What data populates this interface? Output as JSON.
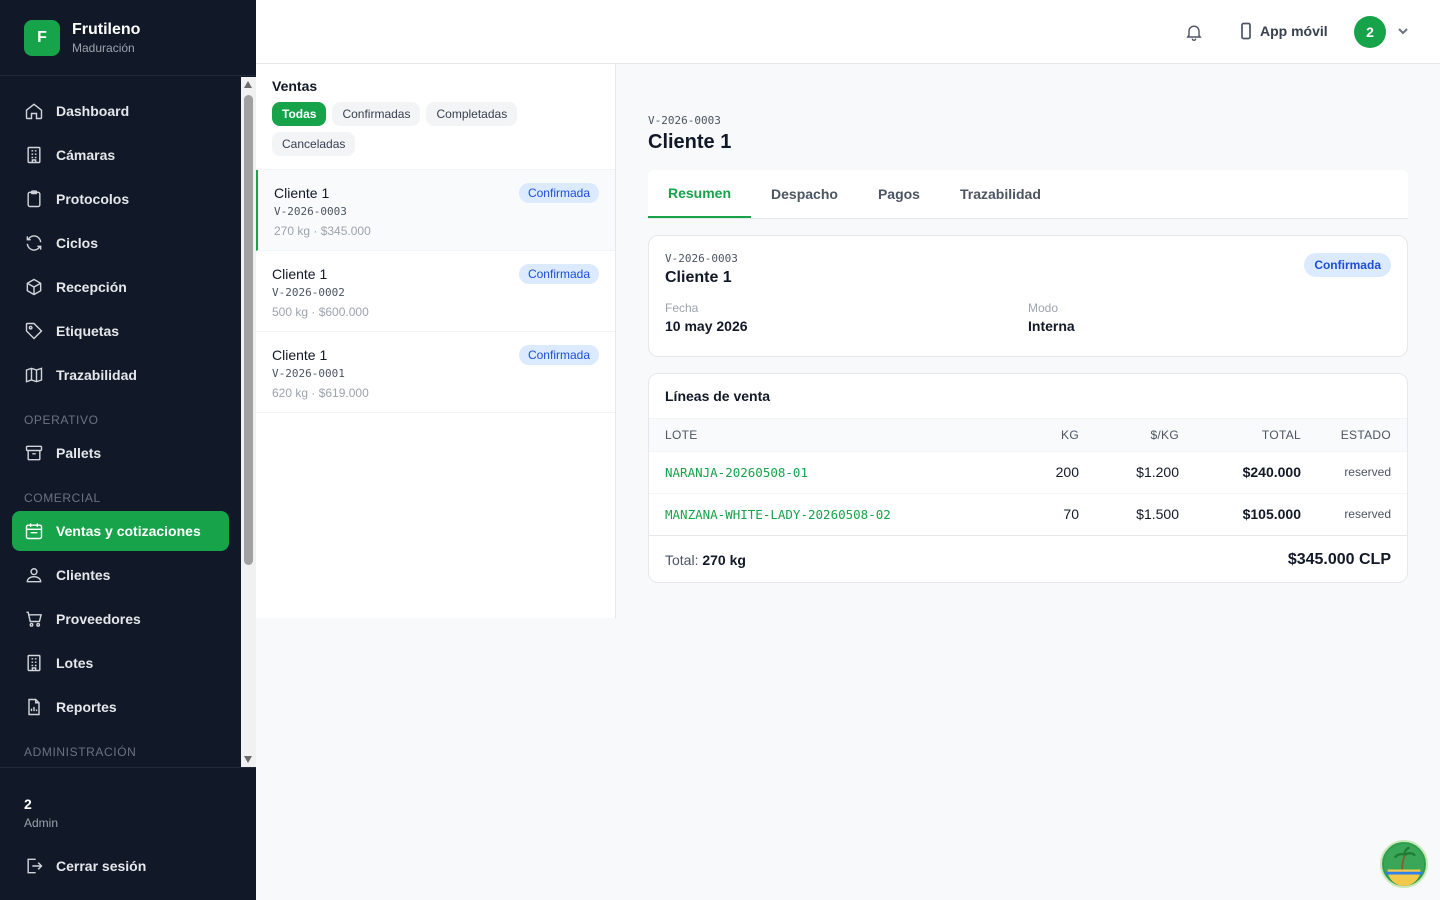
{
  "brand": {
    "initial": "F",
    "name": "Frutileno",
    "subtitle": "Maduración"
  },
  "nav": {
    "main": [
      "Dashboard",
      "Cámaras",
      "Protocolos",
      "Ciclos",
      "Recepción",
      "Etiquetas",
      "Trazabilidad"
    ],
    "section_operativo": "OPERATIVO",
    "operativo": [
      "Pallets"
    ],
    "section_comercial": "COMERCIAL",
    "comercial": [
      "Ventas y cotizaciones",
      "Clientes",
      "Proveedores",
      "Lotes",
      "Reportes"
    ],
    "section_admin": "ADMINISTRACIÓN",
    "active": "Ventas y cotizaciones"
  },
  "user": {
    "name": "2",
    "role": "Admin",
    "logout": "Cerrar sesión",
    "avatar": "2"
  },
  "topbar": {
    "app_movil": "App móvil"
  },
  "list": {
    "title": "Ventas",
    "filters": [
      "Todas",
      "Confirmadas",
      "Completadas",
      "Canceladas"
    ],
    "items": [
      {
        "client": "Cliente 1",
        "code": "V-2026-0003",
        "meta": "270 kg · $345.000",
        "status": "Confirmada"
      },
      {
        "client": "Cliente 1",
        "code": "V-2026-0002",
        "meta": "500 kg · $600.000",
        "status": "Confirmada"
      },
      {
        "client": "Cliente 1",
        "code": "V-2026-0001",
        "meta": "620 kg · $619.000",
        "status": "Confirmada"
      }
    ]
  },
  "detail": {
    "code": "V-2026-0003",
    "client": "Cliente 1",
    "tabs": [
      "Resumen",
      "Despacho",
      "Pagos",
      "Trazabilidad"
    ],
    "summary": {
      "code": "V-2026-0003",
      "client": "Cliente 1",
      "status": "Confirmada",
      "fecha_label": "Fecha",
      "fecha": "10 may 2026",
      "modo_label": "Modo",
      "modo": "Interna"
    },
    "lines": {
      "title": "Líneas de venta",
      "headers": [
        "LOTE",
        "KG",
        "$/KG",
        "TOTAL",
        "ESTADO"
      ],
      "rows": [
        {
          "lote": "NARANJA-20260508-01",
          "kg": "200",
          "price": "$1.200",
          "total": "$240.000",
          "estado": "reserved"
        },
        {
          "lote": "MANZANA-WHITE-LADY-20260508-02",
          "kg": "70",
          "price": "$1.500",
          "total": "$105.000",
          "estado": "reserved"
        }
      ],
      "total_label": "Total:",
      "total_kg": "270 kg",
      "total_amount": "$345.000 CLP"
    }
  }
}
